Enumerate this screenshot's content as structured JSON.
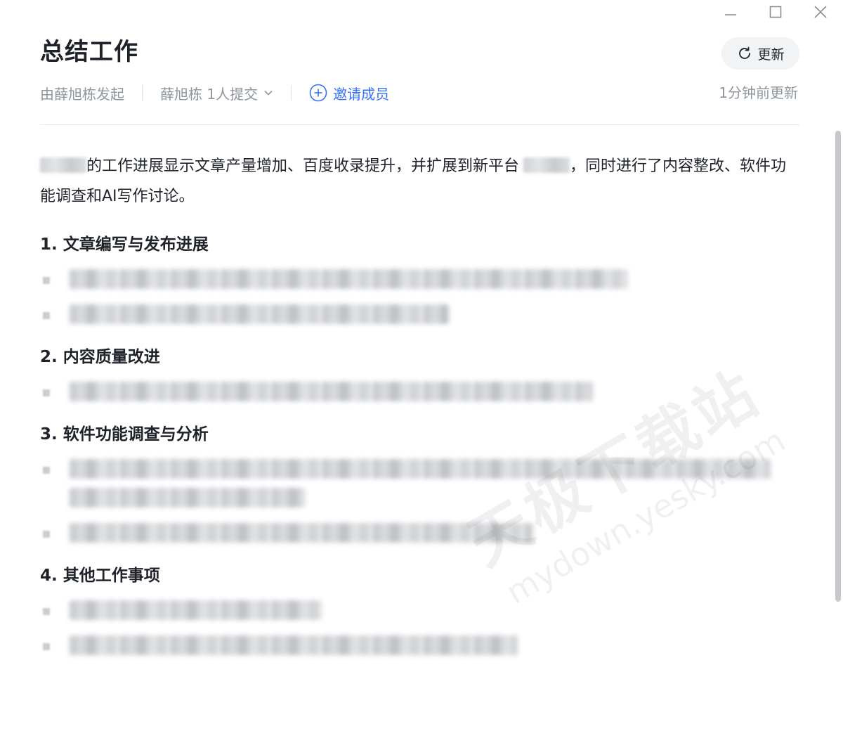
{
  "window_controls": {
    "minimize_icon": "minimize-icon",
    "maximize_icon": "maximize-icon",
    "close_icon": "close-icon"
  },
  "header": {
    "title": "总结工作",
    "refresh_label": "更新",
    "initiator": "由薛旭栋发起",
    "submitter": "薛旭栋 1人提交",
    "invite_label": "邀请成员",
    "updated_text": "1分钟前更新"
  },
  "summary": {
    "part1": "的工作进展显示文章产量增加、百度收录提升，并扩展到新平台",
    "part2": "，同时进行了内容整改、软件功能调查和AI写作讨论。"
  },
  "sections": [
    {
      "heading": "1. 文章编写与发布进展"
    },
    {
      "heading": "2. 内容质量改进"
    },
    {
      "heading": "3. 软件功能调查与分析"
    },
    {
      "heading": "4. 其他工作事项"
    }
  ],
  "watermark": {
    "cn": "天极下载站",
    "en": "mydown.yesky.com"
  },
  "colors": {
    "accent": "#3370ff",
    "text": "#1f2329",
    "muted": "#8f959e"
  }
}
